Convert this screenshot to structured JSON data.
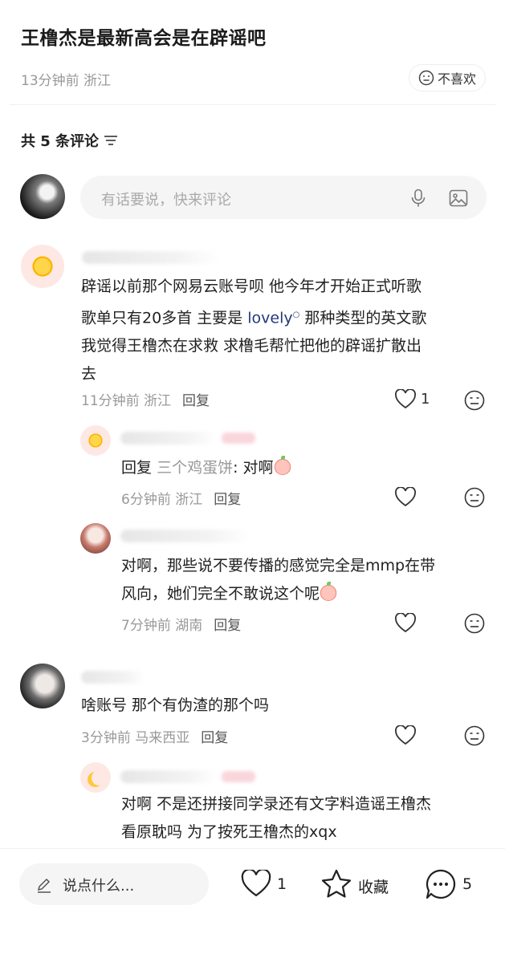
{
  "post": {
    "title": "王橹杰是最新高会是在辟谣吧",
    "meta_time": "13分钟前",
    "meta_location": "浙江",
    "dislike_label": "不喜欢"
  },
  "comments_header": {
    "count_label": "共 5 条评论"
  },
  "comment_input": {
    "placeholder": "有话要说，快来评论"
  },
  "comments": [
    {
      "lines": [
        "辟谣以前那个网易云账号呗  他今年才开始正式听歌",
        "歌单只有20多首   主要是",
        "lovely",
        "那种类型的英文歌",
        "我觉得王橹杰在求救  求橹毛帮忙把他的辟谣扩散出",
        "去"
      ],
      "time": "11分钟前",
      "location": "浙江",
      "reply_label": "回复",
      "likes": "1"
    },
    {
      "reply_prefix": "回复",
      "reply_to": "三个鸡蛋饼",
      "text": ": 对啊",
      "time": "6分钟前",
      "location": "浙江",
      "reply_label": "回复"
    },
    {
      "lines": [
        "对啊，那些说不要传播的感觉完全是mmp在带",
        "风向，她们完全不敢说这个呢"
      ],
      "time": "7分钟前",
      "location": "湖南",
      "reply_label": "回复"
    },
    {
      "text": "啥账号 那个有伪渣的那个吗",
      "time": "3分钟前",
      "location": "马来西亚",
      "reply_label": "回复"
    },
    {
      "lines": [
        "对啊  不是还拼接同学录还有文字料造谣王橹杰",
        "看原耽吗   为了按死王橹杰的xqx"
      ]
    }
  ],
  "bottom_bar": {
    "say_placeholder": "说点什么...",
    "likes": "1",
    "favorite_label": "收藏",
    "comments": "5"
  },
  "icons": {
    "dislike": "neutral-face-icon",
    "sort": "sort-icon",
    "mic": "mic-icon",
    "image": "image-icon",
    "heart": "heart-icon",
    "face": "neutral-face-icon",
    "pencil": "pencil-icon",
    "star": "star-icon",
    "chat": "chat-bubble-icon"
  }
}
